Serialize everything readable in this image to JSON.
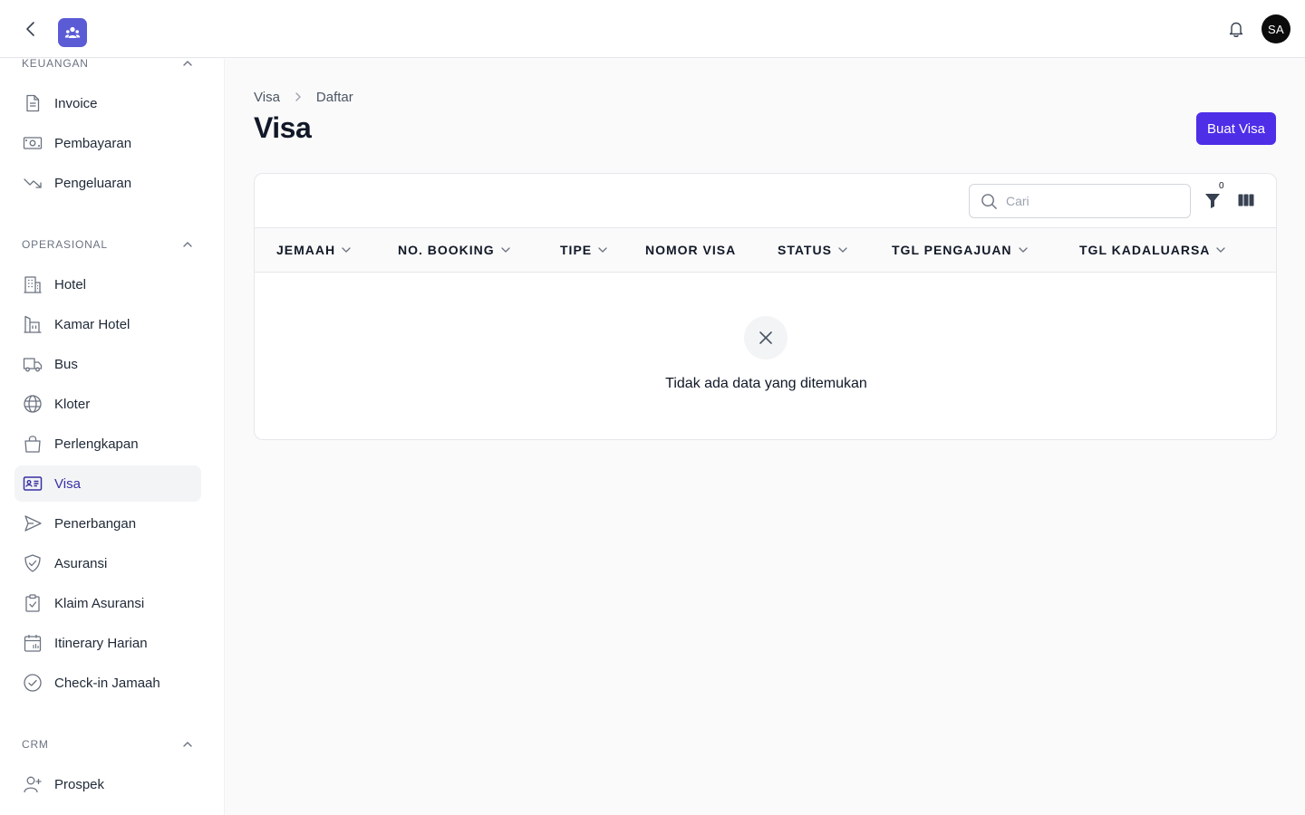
{
  "header": {
    "avatar_initials": "SA",
    "brand_color": "#5b5bd6"
  },
  "sidebar": {
    "sections": [
      {
        "title": "KEUANGAN",
        "items": [
          {
            "label": "Invoice",
            "icon": "document-icon"
          },
          {
            "label": "Pembayaran",
            "icon": "cash-icon"
          },
          {
            "label": "Pengeluaran",
            "icon": "trend-down-icon"
          }
        ]
      },
      {
        "title": "OPERASIONAL",
        "items": [
          {
            "label": "Hotel",
            "icon": "building-icon"
          },
          {
            "label": "Kamar Hotel",
            "icon": "building-room-icon"
          },
          {
            "label": "Bus",
            "icon": "truck-icon"
          },
          {
            "label": "Kloter",
            "icon": "globe-icon"
          },
          {
            "label": "Perlengkapan",
            "icon": "shopping-bag-icon"
          },
          {
            "label": "Visa",
            "icon": "id-card-icon",
            "active": true
          },
          {
            "label": "Penerbangan",
            "icon": "paper-plane-icon"
          },
          {
            "label": "Asuransi",
            "icon": "shield-check-icon"
          },
          {
            "label": "Klaim Asuransi",
            "icon": "clipboard-check-icon"
          },
          {
            "label": "Itinerary Harian",
            "icon": "calendar-icon"
          },
          {
            "label": "Check-in Jamaah",
            "icon": "check-circle-icon"
          }
        ]
      },
      {
        "title": "CRM",
        "items": [
          {
            "label": "Prospek",
            "icon": "user-plus-icon"
          }
        ]
      }
    ]
  },
  "main": {
    "breadcrumb": [
      "Visa",
      "Daftar"
    ],
    "title": "Visa",
    "create_button": "Buat Visa",
    "accent_color": "#4f2ee8",
    "search_placeholder": "Cari",
    "filter_count": "0",
    "columns": [
      {
        "label": "JEMAAH",
        "sortable": true
      },
      {
        "label": "NO. BOOKING",
        "sortable": true
      },
      {
        "label": "TIPE",
        "sortable": true
      },
      {
        "label": "NOMOR VISA",
        "sortable": false
      },
      {
        "label": "STATUS",
        "sortable": true
      },
      {
        "label": "TGL PENGAJUAN",
        "sortable": true
      },
      {
        "label": "TGL KADALUARSA",
        "sortable": true
      }
    ],
    "empty_message": "Tidak ada data yang ditemukan"
  }
}
